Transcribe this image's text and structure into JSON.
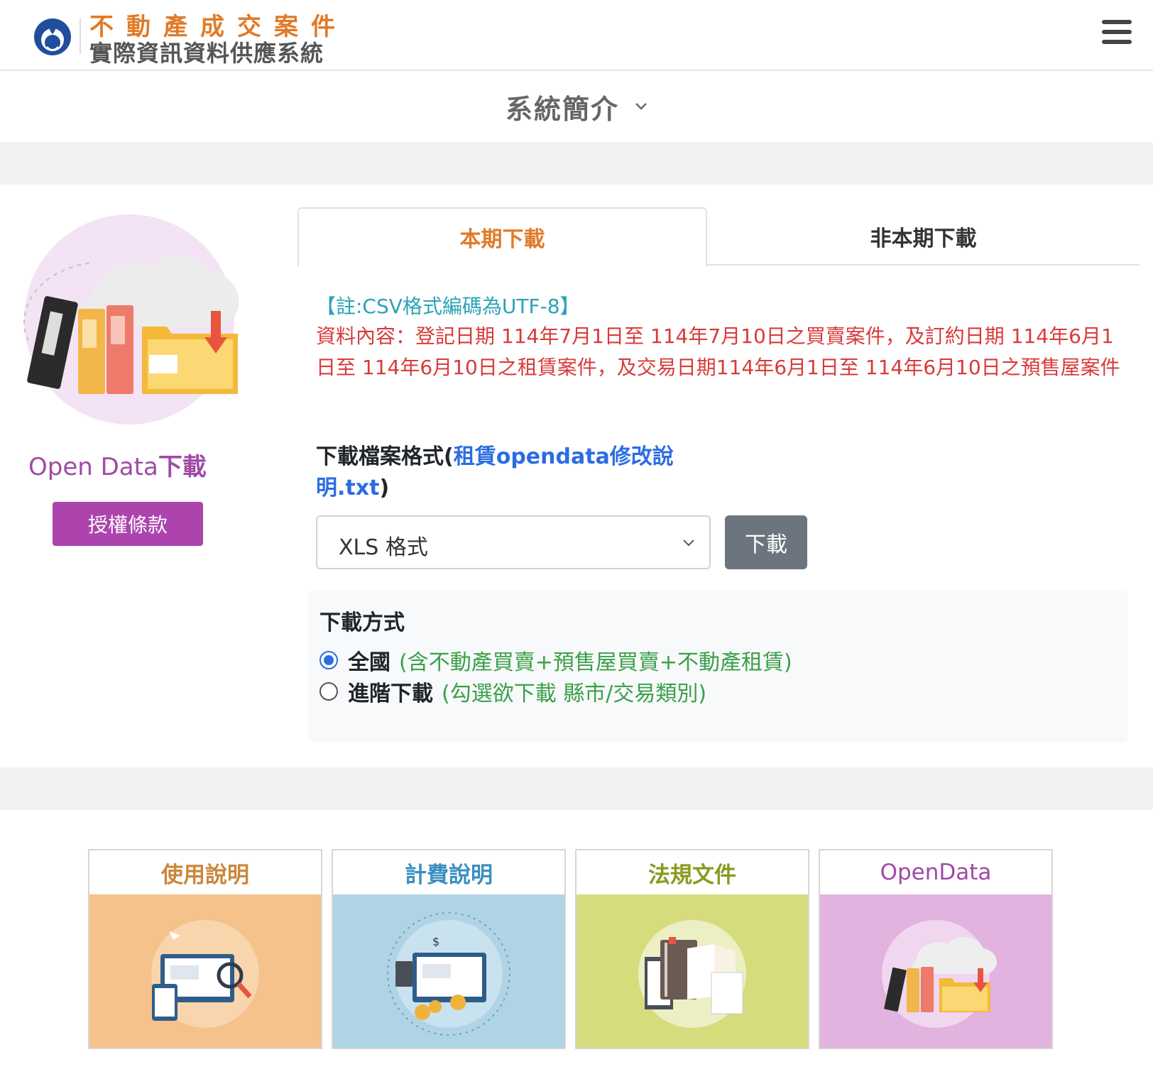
{
  "header": {
    "title_top": "不動產成交案件",
    "title_bottom": "實際資訊資料供應系統",
    "logo_icon": "moon-logo-icon",
    "menu_icon": "hamburger-menu-icon"
  },
  "intro": {
    "label": "系統簡介",
    "icon": "chevron-down-icon"
  },
  "sidebar": {
    "caption_prefix": "Open Data",
    "caption_suffix": "下載",
    "license_button": "授權條款"
  },
  "tabs": [
    {
      "label": "本期下載",
      "active": true
    },
    {
      "label": "非本期下載",
      "active": false
    }
  ],
  "download": {
    "note": "【註:CSV格式編碼為UTF-8】",
    "content": "資料內容：登記日期 114年7月1日至 114年7月10日之買賣案件，及訂約日期 114年6月1日至 114年6月10日之租賃案件，及交易日期114年6月1日至 114年6月10日之預售屋案件",
    "format_label_prefix": "下載檔案格式(",
    "format_link": "租賃opendata修改說明.txt",
    "format_label_suffix": ")",
    "select_value": "XLS 格式",
    "download_button": "下載"
  },
  "method": {
    "title": "下載方式",
    "options": [
      {
        "label": "全國",
        "desc": "(含不動產買賣+預售屋買賣+不動產租賃)",
        "checked": true
      },
      {
        "label": "進階下載",
        "desc": "(勾選欲下載 縣市/交易類別)",
        "checked": false
      }
    ]
  },
  "cards": [
    {
      "title": "使用說明",
      "color": "#f4c28a"
    },
    {
      "title": "計費說明",
      "color": "#afd4e6"
    },
    {
      "title": "法規文件",
      "color": "#d6dc7c"
    },
    {
      "title": "OpenData",
      "color": "#e2b3de"
    }
  ],
  "colors": {
    "accent_orange": "#e07b2a",
    "accent_purple": "#ad43ad",
    "content_red": "#d93a3a",
    "note_teal": "#2aa3b8",
    "desc_green": "#3aa04a",
    "link_blue": "#2b6de0"
  }
}
